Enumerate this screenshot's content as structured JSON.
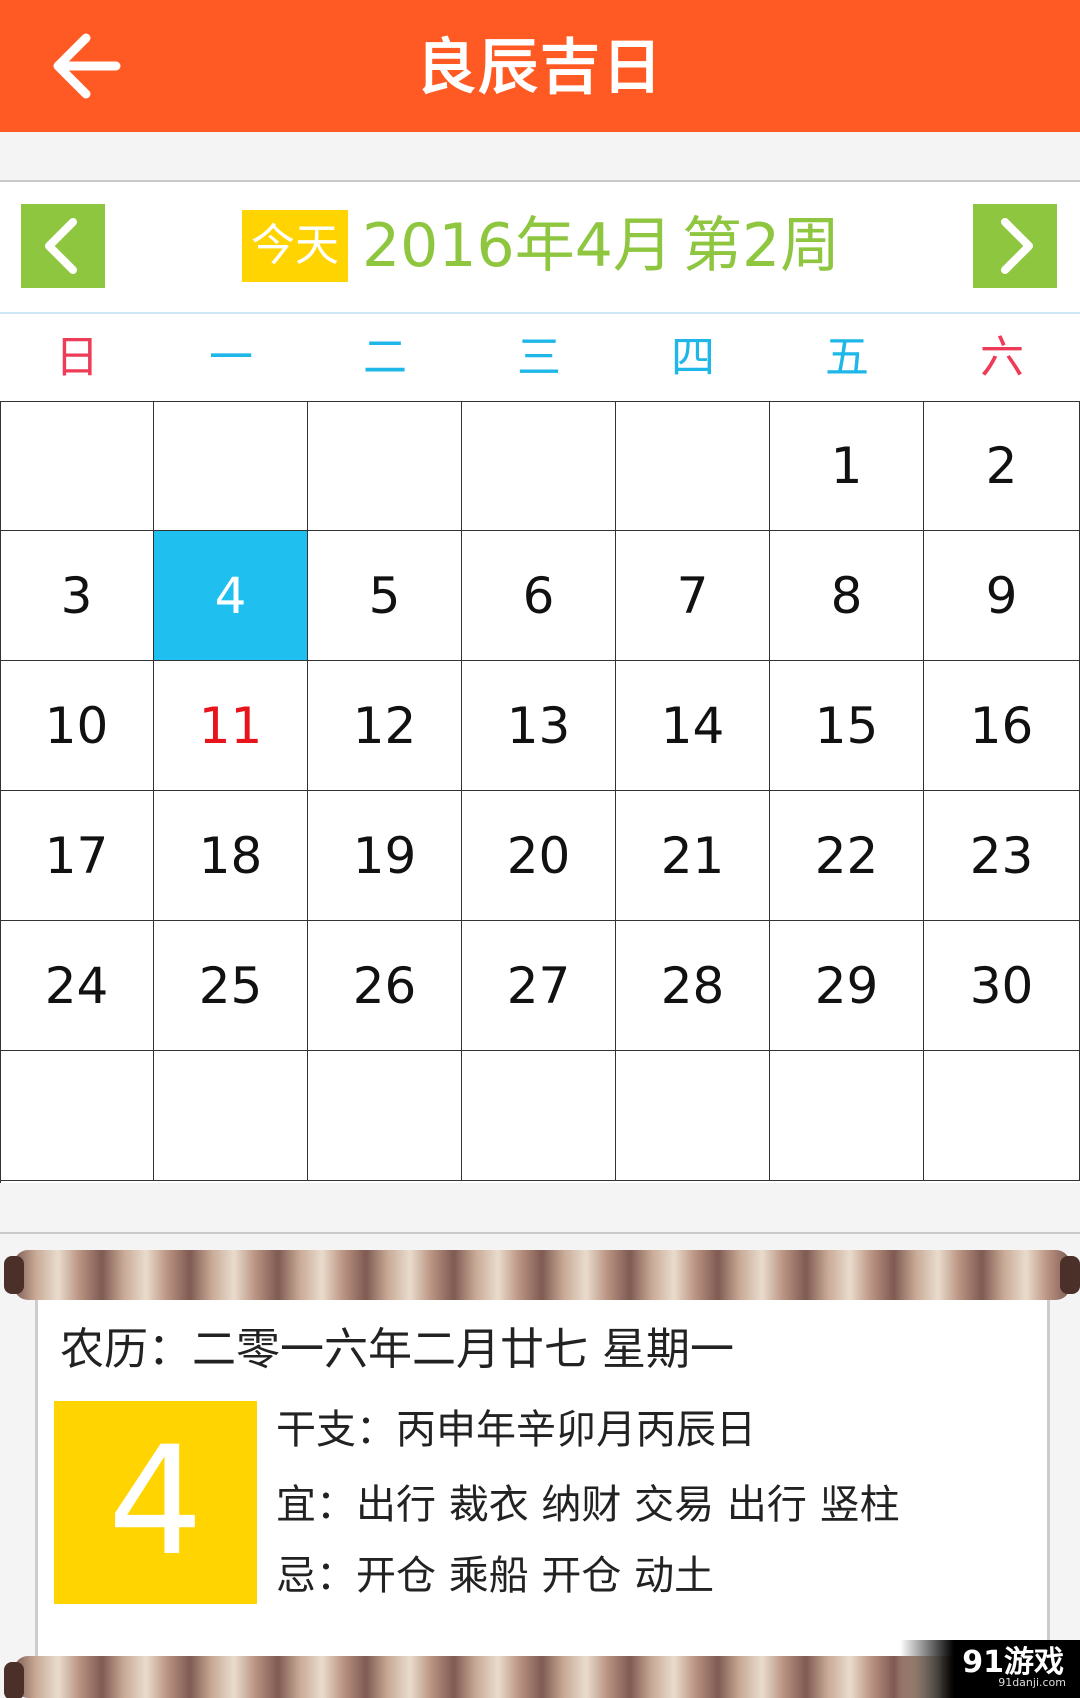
{
  "header": {
    "title": "良辰吉日",
    "back_icon": "arrow-left-icon"
  },
  "nav": {
    "prev_icon": "chevron-left-icon",
    "next_icon": "chevron-right-icon",
    "today_label": "今天",
    "year_month": "2016年4月",
    "week": "第2周",
    "accent_color": "#8ec63f"
  },
  "weekdays": [
    {
      "label": "日",
      "color": "#ee3b57"
    },
    {
      "label": "一",
      "color": "#1fb6e8"
    },
    {
      "label": "二",
      "color": "#1fb6e8"
    },
    {
      "label": "三",
      "color": "#1fb6e8"
    },
    {
      "label": "四",
      "color": "#1fb6e8"
    },
    {
      "label": "五",
      "color": "#1fb6e8"
    },
    {
      "label": "六",
      "color": "#ee3b57"
    }
  ],
  "calendar": {
    "selected_day": "4",
    "highlight_day": "11",
    "rows": [
      [
        "",
        "",
        "",
        "",
        "",
        "1",
        "2"
      ],
      [
        "3",
        "4",
        "5",
        "6",
        "7",
        "8",
        "9"
      ],
      [
        "10",
        "11",
        "12",
        "13",
        "14",
        "15",
        "16"
      ],
      [
        "17",
        "18",
        "19",
        "20",
        "21",
        "22",
        "23"
      ],
      [
        "24",
        "25",
        "26",
        "27",
        "28",
        "29",
        "30"
      ],
      [
        "",
        "",
        "",
        "",
        "",
        "",
        ""
      ]
    ]
  },
  "detail": {
    "lunar": "农历：二零一六年二月廿七 星期一",
    "day": "4",
    "ganzhi": "干支：丙申年辛卯月丙辰日",
    "yi": "宜：出行 裁衣 纳财 交易 出行 竖柱",
    "ji": "忌：开仓 乘船 开仓 动土"
  },
  "watermark": {
    "brand": "91游戏",
    "site": "91danji.com"
  }
}
